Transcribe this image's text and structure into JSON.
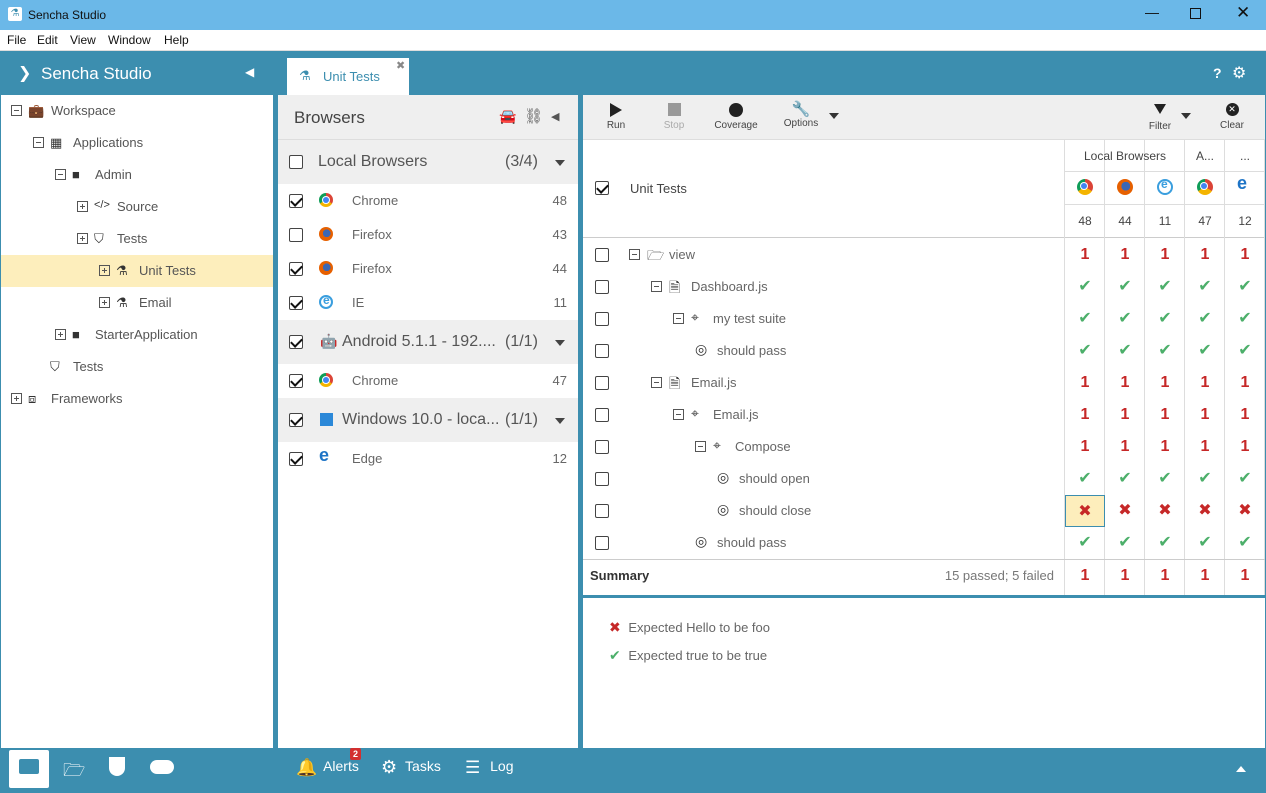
{
  "window": {
    "title": "Sencha Studio"
  },
  "menu": [
    "File",
    "Edit",
    "View",
    "Window",
    "Help"
  ],
  "sidebar": {
    "title": "Sencha Studio",
    "tree": [
      {
        "label": "Workspace",
        "level": 0,
        "expander": "minus"
      },
      {
        "label": "Applications",
        "level": 1,
        "expander": "minus"
      },
      {
        "label": "Admin",
        "level": 2,
        "expander": "minus"
      },
      {
        "label": "Source",
        "level": 3,
        "expander": "plus"
      },
      {
        "label": "Tests",
        "level": 3,
        "expander": "plus"
      },
      {
        "label": "Unit Tests",
        "level": 4,
        "expander": "plus",
        "selected": true
      },
      {
        "label": "Email",
        "level": 4,
        "expander": "plus"
      },
      {
        "label": "StarterApplication",
        "level": 2,
        "expander": "plus"
      },
      {
        "label": "Tests",
        "level": 1,
        "expander": "none"
      },
      {
        "label": "Frameworks",
        "level": 0,
        "expander": "plus"
      }
    ]
  },
  "tab": {
    "label": "Unit Tests"
  },
  "browsers": {
    "title": "Browsers",
    "groups": [
      {
        "label": "Local Browsers",
        "count": "(3/4)",
        "checked": false,
        "items": [
          {
            "label": "Chrome",
            "version": "48",
            "checked": true,
            "icon": "chrome"
          },
          {
            "label": "Firefox",
            "version": "43",
            "checked": false,
            "icon": "firefox"
          },
          {
            "label": "Firefox",
            "version": "44",
            "checked": true,
            "icon": "firefox"
          },
          {
            "label": "IE",
            "version": "11",
            "checked": true,
            "icon": "ie"
          }
        ]
      },
      {
        "label": "Android 5.1.1 - 192....",
        "count": "(1/1)",
        "checked": true,
        "items": [
          {
            "label": "Chrome",
            "version": "47",
            "checked": true,
            "icon": "chrome"
          }
        ]
      },
      {
        "label": "Windows 10.0 - loca...",
        "count": "(1/1)",
        "checked": true,
        "items": [
          {
            "label": "Edge",
            "version": "12",
            "checked": true,
            "icon": "edge"
          }
        ]
      }
    ]
  },
  "toolbar": {
    "run": "Run",
    "stop": "Stop",
    "coverage": "Coverage",
    "options": "Options",
    "filter": "Filter",
    "clear": "Clear"
  },
  "grid": {
    "root_label": "Unit Tests",
    "col_groups": [
      "Local Browsers",
      "A...",
      "..."
    ],
    "columns": [
      {
        "icon": "chrome",
        "version": "48"
      },
      {
        "icon": "firefox",
        "version": "44"
      },
      {
        "icon": "ie",
        "version": "11"
      },
      {
        "icon": "chrome",
        "version": "47"
      },
      {
        "icon": "edge",
        "version": "12"
      }
    ],
    "rows": [
      {
        "label": "view",
        "indent": 0,
        "type": "folder",
        "expander": "minus",
        "result": "1"
      },
      {
        "label": "Dashboard.js",
        "indent": 1,
        "type": "file",
        "expander": "minus",
        "result": "pass"
      },
      {
        "label": "my test suite",
        "indent": 2,
        "type": "suite",
        "expander": "minus",
        "result": "pass"
      },
      {
        "label": "should pass",
        "indent": 3,
        "type": "spec",
        "expander": "none",
        "result": "pass"
      },
      {
        "label": "Email.js",
        "indent": 1,
        "type": "file",
        "expander": "minus",
        "result": "1"
      },
      {
        "label": "Email.js",
        "indent": 2,
        "type": "suite",
        "expander": "minus",
        "result": "1"
      },
      {
        "label": "Compose",
        "indent": 3,
        "type": "suite",
        "expander": "minus",
        "result": "1"
      },
      {
        "label": "should open",
        "indent": 4,
        "type": "spec",
        "expander": "none",
        "result": "pass"
      },
      {
        "label": "should close",
        "indent": 4,
        "type": "spec",
        "expander": "none",
        "result": "fail"
      },
      {
        "label": "should pass",
        "indent": 3,
        "type": "spec",
        "expander": "none",
        "result": "pass"
      }
    ],
    "summary_label": "Summary",
    "summary_text": "15 passed; 5 failed",
    "summary_values": [
      "1",
      "1",
      "1",
      "1",
      "1"
    ]
  },
  "results": [
    {
      "status": "fail",
      "text": "Expected Hello to be foo"
    },
    {
      "status": "pass",
      "text": "Expected true to be true"
    }
  ],
  "footer": {
    "alerts": "Alerts",
    "alerts_badge": "2",
    "tasks": "Tasks",
    "log": "Log"
  },
  "colors": {
    "accent": "#3c8eaf",
    "titlebar": "#6bb8e8",
    "selected": "#fdeebc",
    "fail": "#c62828",
    "pass": "#4caf6a"
  }
}
